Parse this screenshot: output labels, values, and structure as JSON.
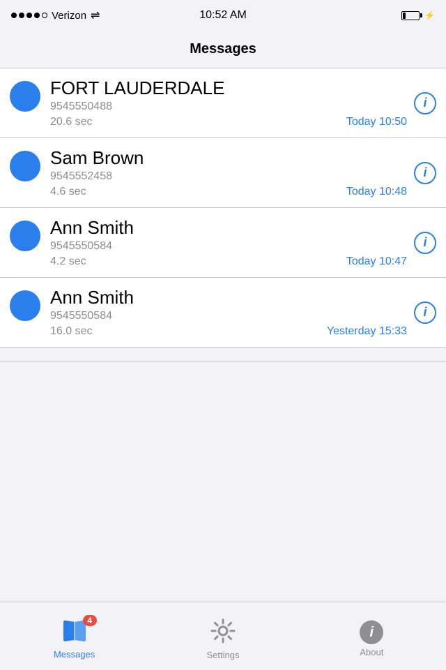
{
  "statusBar": {
    "carrier": "Verizon",
    "time": "10:52 AM",
    "batteryLevel": "low"
  },
  "navBar": {
    "title": "Messages"
  },
  "messages": [
    {
      "id": 1,
      "name": "FORT LAUDERDALE",
      "phone": "9545550488",
      "duration": "20.6 sec",
      "time": "Today 10:50"
    },
    {
      "id": 2,
      "name": "Sam Brown",
      "phone": "9545552458",
      "duration": "4.6 sec",
      "time": "Today 10:48"
    },
    {
      "id": 3,
      "name": "Ann Smith",
      "phone": "9545550584",
      "duration": "4.2 sec",
      "time": "Today 10:47"
    },
    {
      "id": 4,
      "name": "Ann Smith",
      "phone": "9545550584",
      "duration": "16.0 sec",
      "time": "Yesterday 15:33"
    }
  ],
  "tabBar": {
    "tabs": [
      {
        "id": "messages",
        "label": "Messages",
        "badge": "4",
        "active": true
      },
      {
        "id": "settings",
        "label": "Settings",
        "badge": null,
        "active": false
      },
      {
        "id": "about",
        "label": "About",
        "badge": null,
        "active": false
      }
    ]
  }
}
